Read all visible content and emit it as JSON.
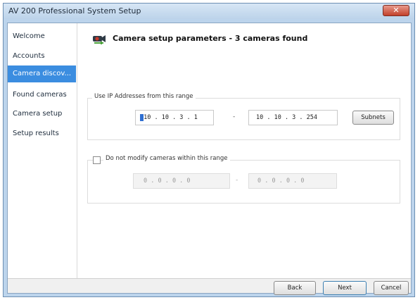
{
  "window": {
    "title": "AV 200 Professional System Setup",
    "close_glyph": "✕"
  },
  "sidebar": {
    "items": [
      {
        "label": "Welcome",
        "active": false
      },
      {
        "label": "Accounts",
        "active": false
      },
      {
        "label": "Camera discov...",
        "active": true
      },
      {
        "label": "Found cameras",
        "active": false
      },
      {
        "label": "Camera setup",
        "active": false
      },
      {
        "label": "Setup results",
        "active": false
      }
    ]
  },
  "header": {
    "icon": "camera-icon",
    "text": "Camera setup parameters - 3 cameras found"
  },
  "ip_range": {
    "label": "Use IP Addresses from this range",
    "start": "10 . 10 . 3 . 1",
    "separator": "-",
    "end": "10 . 10 . 3 . 254",
    "subnets_label": "Subnets"
  },
  "exclude_range": {
    "label": "Do not modify cameras within this range",
    "checked": false,
    "start": "0 . 0 . 0 . 0",
    "separator": "-",
    "end": "0 . 0 . 0 . 0"
  },
  "footer": {
    "back": "Back",
    "next": "Next",
    "cancel": "Cancel"
  },
  "colors": {
    "accent": "#3b8de0",
    "frame": "#bcd4ec",
    "close": "#c2402b"
  }
}
